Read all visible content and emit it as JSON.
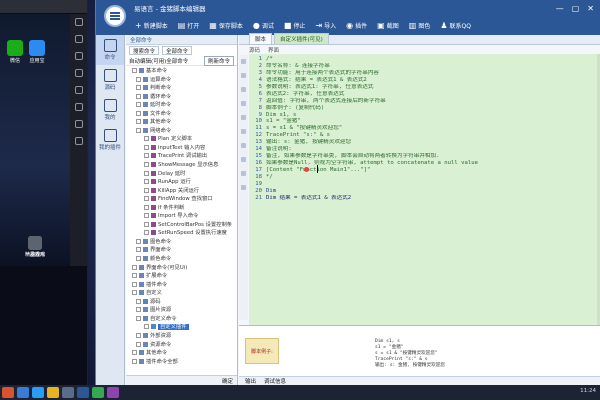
{
  "emulator": {
    "window_title": "",
    "apps": [
      {
        "label": "微信",
        "color": "#1aad19"
      },
      {
        "label": "应用宝",
        "color": "#2a8cf0"
      }
    ],
    "dock": [
      {
        "label": "游戏",
        "color": "#c53a2e"
      },
      {
        "label": "一次游戏",
        "color": "#e09b20"
      },
      {
        "label": "精品应用",
        "color": "#5c6470"
      }
    ]
  },
  "ide": {
    "title": "易语言 - 金猪脚本编辑器",
    "window_controls": [
      "—",
      "▢",
      "✕"
    ],
    "toolbar": [
      {
        "icon": "+",
        "label": "新建脚本"
      },
      {
        "icon": "▤",
        "label": "打开"
      },
      {
        "icon": "▦",
        "label": "保存脚本"
      },
      {
        "icon": "●",
        "label": "调试"
      },
      {
        "icon": "■",
        "label": "停止"
      },
      {
        "icon": "⇥",
        "label": "导入"
      },
      {
        "icon": "◉",
        "label": "插件"
      },
      {
        "icon": "▣",
        "label": "截图"
      },
      {
        "icon": "▥",
        "label": "图色"
      },
      {
        "icon": "♟",
        "label": "联系QQ"
      }
    ],
    "leftnav": [
      {
        "label": "命令"
      },
      {
        "label": "源码"
      },
      {
        "label": "我的"
      },
      {
        "label": "我的插件"
      }
    ],
    "tree": {
      "tab": "全部命令",
      "search_tabs": [
        "搜索命令",
        "全部命令"
      ],
      "header_label": "自动编辑(可用)全部命令",
      "header_button": "刷新命令",
      "rows": [
        {
          "text": "基本命令",
          "icon": "ti",
          "indent": 6
        },
        {
          "text": "运算命令",
          "icon": "ti",
          "indent": 10
        },
        {
          "text": "判断命令",
          "icon": "ti",
          "indent": 10
        },
        {
          "text": "循环命令",
          "icon": "ti",
          "indent": 10
        },
        {
          "text": "延时命令",
          "icon": "ti",
          "indent": 10
        },
        {
          "text": "文件命令",
          "icon": "ti",
          "indent": 10
        },
        {
          "text": "其他命令",
          "icon": "ti",
          "indent": 10
        },
        {
          "text": "网络命令",
          "icon": "ti",
          "indent": 10
        },
        {
          "text": "Plan 定义脚本",
          "icon": "fn",
          "indent": 18
        },
        {
          "text": "InputText 输入内容",
          "icon": "fn",
          "indent": 18
        },
        {
          "text": "TracePrint 调试输出",
          "icon": "fn",
          "indent": 18
        },
        {
          "text": "ShowMessage 显示信息",
          "icon": "fn",
          "indent": 18
        },
        {
          "text": "Delay 延时",
          "icon": "fn",
          "indent": 18
        },
        {
          "text": "RunApp 运行",
          "icon": "fn",
          "indent": 18
        },
        {
          "text": "KillApp 关闭运行",
          "icon": "fn",
          "indent": 18
        },
        {
          "text": "FindWindow 查找窗口",
          "icon": "fn",
          "indent": 18
        },
        {
          "text": "If 条件判断",
          "icon": "fn",
          "indent": 18
        },
        {
          "text": "Import 导入命令",
          "icon": "fn",
          "indent": 18
        },
        {
          "text": "SetControlBarPos 设置控制条",
          "icon": "fn",
          "indent": 18
        },
        {
          "text": "SetRunSpeed 设置执行速度",
          "icon": "fn",
          "indent": 18
        },
        {
          "text": "图色命令",
          "icon": "ti",
          "indent": 10
        },
        {
          "text": "界面命令",
          "icon": "ti",
          "indent": 10
        },
        {
          "text": "颜色命令",
          "icon": "ti",
          "indent": 10
        },
        {
          "text": "界面命令(可见Ui)",
          "icon": "ti",
          "indent": 6
        },
        {
          "text": "扩展命令",
          "icon": "ti",
          "indent": 6
        },
        {
          "text": "插件命令",
          "icon": "ti",
          "indent": 6
        },
        {
          "text": "自定义",
          "icon": "ti",
          "indent": 6
        },
        {
          "text": "源码",
          "icon": "doc",
          "indent": 10
        },
        {
          "text": "图片资源",
          "icon": "ti",
          "indent": 10
        },
        {
          "text": "自定义命令",
          "icon": "ti",
          "indent": 10
        },
        {
          "text": "自定义插件",
          "icon": "doc",
          "indent": 18,
          "selected": true
        },
        {
          "text": "外部资源",
          "icon": "ti",
          "indent": 10
        },
        {
          "text": "资源命令",
          "icon": "ti",
          "indent": 10
        },
        {
          "text": "其他命令",
          "icon": "ti",
          "indent": 6
        },
        {
          "text": "插件命令全部",
          "icon": "ti",
          "indent": 6
        }
      ],
      "footer_button": "确定"
    },
    "editor": {
      "tabs": [
        {
          "label": "脚本",
          "active": false
        },
        {
          "label": "自定义插件(可见)",
          "active": true
        }
      ],
      "subbar": [
        "源码",
        "界面"
      ],
      "line_numbers": [
        "1",
        "2",
        "3",
        "4",
        "5",
        "6",
        "7",
        "8",
        "9",
        "10",
        "11",
        "12",
        "13",
        "14",
        "15",
        "16",
        "17",
        "18"
      ],
      "lines": [
        {
          "text": "/*",
          "cls": ""
        },
        {
          "text": "命令名称:   & 连接字符串",
          "cls": ""
        },
        {
          "text": "命令功能:   用于连接两个表达式的字符串内容",
          "cls": ""
        },
        {
          "text": "语法格式:   结果 = 表达式1 & 表达式2",
          "cls": ""
        },
        {
          "text": "参数说明:   表达式1: 字符串, 任意表达式",
          "cls": ""
        },
        {
          "text": "           表达式2: 字符串, 任意表达式",
          "cls": ""
        },
        {
          "text": "返回值:     字符串, 两个表达式连接后的新字符串",
          "cls": ""
        },
        {
          "text": "脚本例子:   (复制代码)",
          "cls": ""
        },
        {
          "text": "Dim s1, s",
          "cls": ""
        },
        {
          "text": "s1 = \"金猪\"",
          "cls": ""
        },
        {
          "text": "s = s1 & \"按键精灵欢迎您\"",
          "cls": ""
        },
        {
          "text": "TracePrint \"s:\" & s",
          "cls": ""
        },
        {
          "text": "输出: s: 金猪, 按键精灵欢迎您",
          "cls": ""
        },
        {
          "text": "备注说明:",
          "cls": ""
        },
        {
          "text": "备注, 如果参数是字符串类, 脚本会自动将两者转换为字符串并相加.",
          "cls": ""
        },
        {
          "text": "如果参数是Null, 则视为空字符串, attempt to concatenate a null value",
          "cls": ""
        },
        {
          "text": "  [Content \"Function Main1\"...\"]\"",
          "cls": ""
        },
        {
          "text": "*/",
          "cls": ""
        }
      ],
      "tail_lines": [
        {
          "num": "19",
          "text": "",
          "cls": ""
        },
        {
          "num": "20",
          "text": "Dim",
          "cls": "kw"
        },
        {
          "num": "21",
          "text": "Dim 结果 = 表达式1 & 表达式2",
          "cls": "ca"
        }
      ]
    },
    "bottom": {
      "label": "脚本例子:",
      "code": [
        "Dim s1, s",
        "s1 = \"金猪\"",
        "s = s1 & \"按键精灵欢迎您\"",
        "TracePrint \"s:\" & s",
        "输出: s: 金猪, 按键精灵欢迎您"
      ],
      "tabs": [
        "输出",
        "调试信息"
      ]
    }
  },
  "taskbar": {
    "items": [
      {
        "color": "#d7542e"
      },
      {
        "color": "#3a7bd5"
      },
      {
        "color": "#2a9df4"
      },
      {
        "color": "#e6b422"
      },
      {
        "color": "#5a6b8c"
      },
      {
        "color": "#2b5797"
      },
      {
        "color": "#34a853"
      },
      {
        "color": "#8e44ad"
      }
    ],
    "clock": "11:24"
  }
}
